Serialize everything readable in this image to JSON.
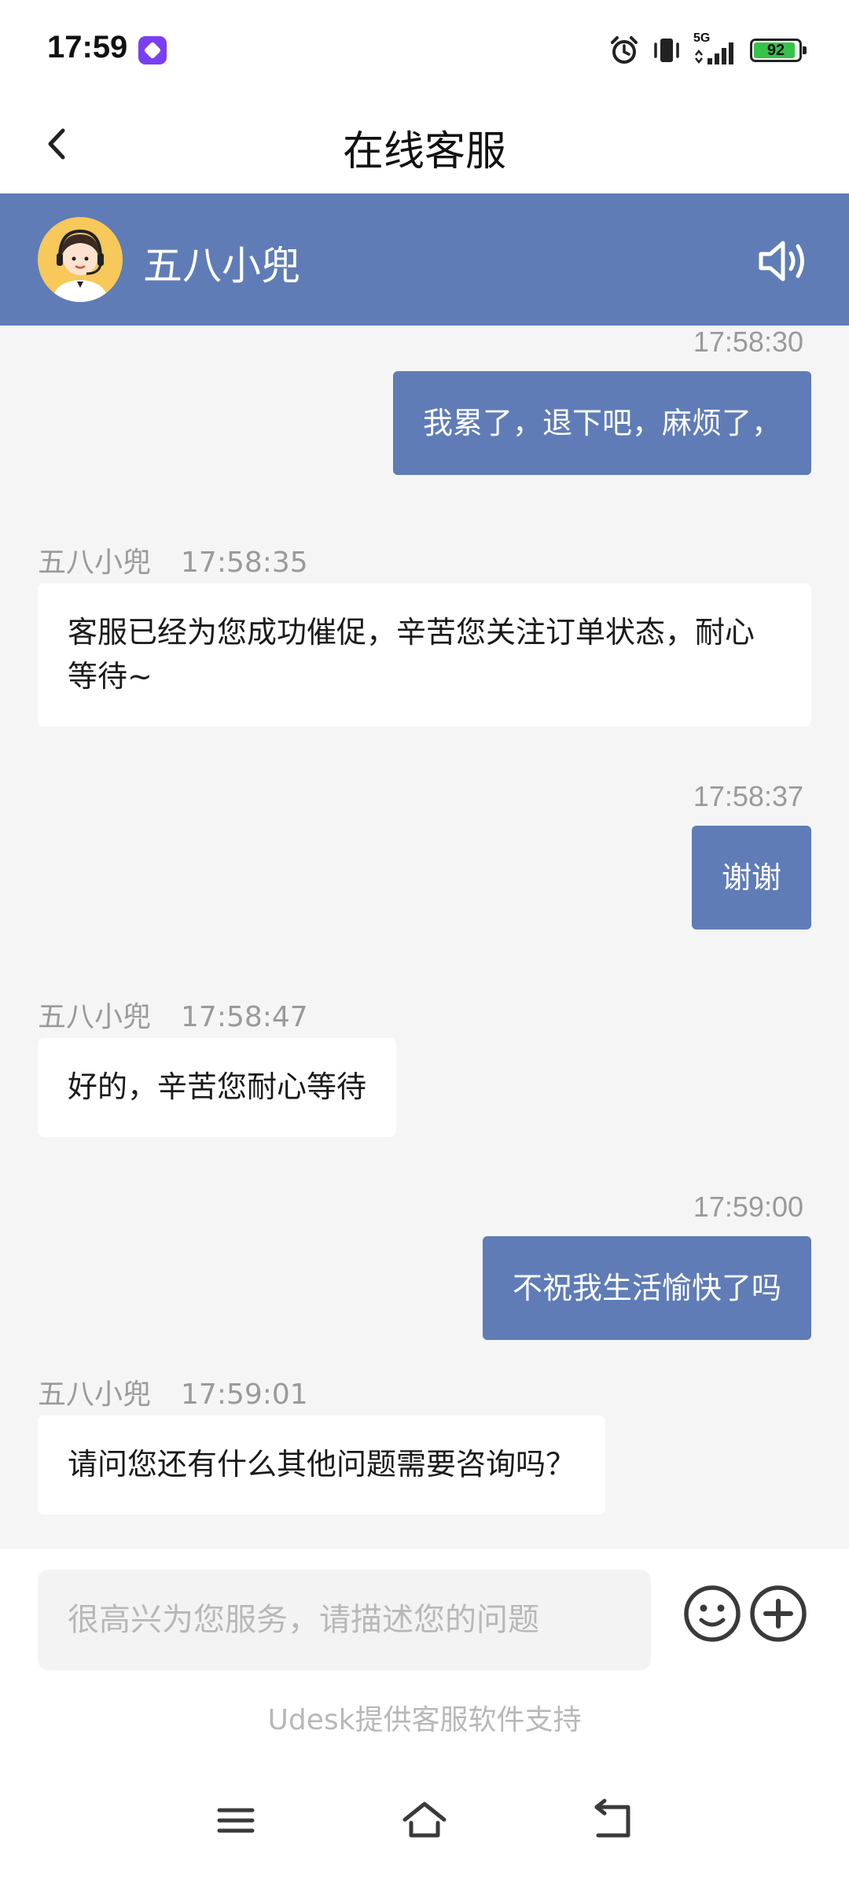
{
  "status_bar": {
    "time": "17:59",
    "network": "5G",
    "battery": "92",
    "battery_level": 0.92,
    "icons": [
      "app-badge-icon",
      "alarm-icon",
      "vibrate-icon",
      "signal-icon",
      "battery-icon"
    ]
  },
  "header": {
    "title": "在线客服",
    "back_icon": "chevron-left-icon"
  },
  "agent": {
    "name": "五八小兜",
    "avatar_icon": "agent-avatar",
    "speaker_icon": "speaker-icon",
    "bar_color": "#5f7cb6"
  },
  "messages": [
    {
      "direction": "out",
      "time": "17:58:30",
      "text": "我累了，退下吧，麻烦了，"
    },
    {
      "direction": "in",
      "sender": "五八小兜",
      "time": "17:58:35",
      "text": "客服已经为您成功催促，辛苦您关注订单状态，耐心等待~"
    },
    {
      "direction": "out",
      "time": "17:58:37",
      "text": "谢谢"
    },
    {
      "direction": "in",
      "sender": "五八小兜",
      "time": "17:58:47",
      "text": "好的，辛苦您耐心等待"
    },
    {
      "direction": "out",
      "time": "17:59:00",
      "text": "不祝我生活愉快了吗"
    },
    {
      "direction": "in",
      "sender": "五八小兜",
      "time": "17:59:01",
      "text": "请问您还有什么其他问题需要咨询吗？"
    }
  ],
  "input": {
    "placeholder": "很高兴为您服务，请描述您的问题",
    "value": "",
    "emoji_icon": "emoji-icon",
    "plus_icon": "plus-circle-icon"
  },
  "footer": {
    "powered_by": "Udesk提供客服软件支持"
  },
  "system_nav": [
    "menu-icon",
    "home-icon",
    "back-icon"
  ],
  "colors": {
    "accent": "#5f7cb6",
    "background": "#f5f5f5",
    "timestamp": "#9a9a9a"
  }
}
